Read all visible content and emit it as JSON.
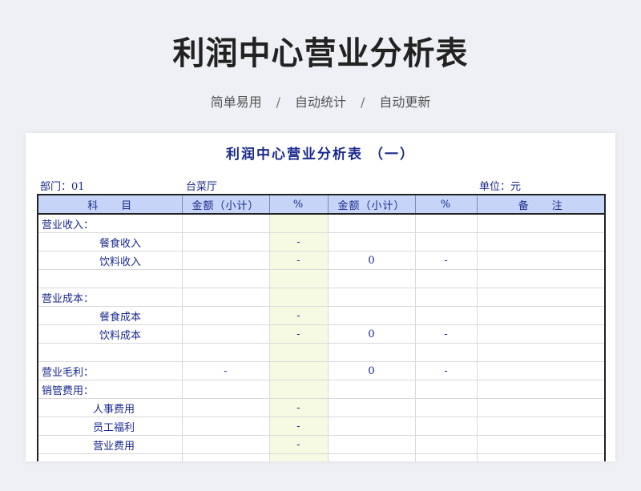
{
  "header": {
    "title": "利润中心营业分析表",
    "tagline": [
      "简单易用",
      "自动统计",
      "自动更新"
    ],
    "separator": "/"
  },
  "sheet": {
    "title": "利润中心营业分析表 （一）",
    "dept_label": "部门：01",
    "location": "台菜厅",
    "unit_label": "单位：元",
    "columns": [
      "科　　目",
      "金额（小计）",
      "%",
      "金额（小计）",
      "%",
      "备　　注"
    ],
    "rows": [
      {
        "label": "营业收入：",
        "amt1": "",
        "pct1": "",
        "amt2": "",
        "pct2": "",
        "note": ""
      },
      {
        "label": "餐食收入",
        "amt1": "",
        "pct1": "-",
        "amt2": "",
        "pct2": "",
        "note": ""
      },
      {
        "label": "饮料收入",
        "amt1": "",
        "pct1": "-",
        "amt2": "0",
        "pct2": "-",
        "note": ""
      },
      {
        "label": "",
        "amt1": "",
        "pct1": "",
        "amt2": "",
        "pct2": "",
        "note": ""
      },
      {
        "label": "营业成本：",
        "amt1": "",
        "pct1": "",
        "amt2": "",
        "pct2": "",
        "note": ""
      },
      {
        "label": "餐食成本",
        "amt1": "",
        "pct1": "-",
        "amt2": "",
        "pct2": "",
        "note": ""
      },
      {
        "label": "饮料成本",
        "amt1": "",
        "pct1": "-",
        "amt2": "0",
        "pct2": "-",
        "note": ""
      },
      {
        "label": "",
        "amt1": "",
        "pct1": "",
        "amt2": "",
        "pct2": "",
        "note": ""
      },
      {
        "label": "营业毛利：",
        "amt1": "-",
        "pct1": "",
        "amt2": "0",
        "pct2": "-",
        "note": ""
      },
      {
        "label": "销管费用：",
        "amt1": "",
        "pct1": "",
        "amt2": "",
        "pct2": "",
        "note": ""
      },
      {
        "label": "人事费用",
        "amt1": "",
        "pct1": "-",
        "amt2": "",
        "pct2": "",
        "note": ""
      },
      {
        "label": "员工福利",
        "amt1": "",
        "pct1": "-",
        "amt2": "",
        "pct2": "",
        "note": ""
      },
      {
        "label": "营业费用",
        "amt1": "",
        "pct1": "-",
        "amt2": "",
        "pct2": "",
        "note": ""
      },
      {
        "label": "",
        "amt1": "",
        "pct1": "",
        "amt2": "",
        "pct2": "",
        "note": ""
      }
    ]
  },
  "colors": {
    "header_fill": "#c6d5f7",
    "pct_fill": "#f6fae2",
    "text_blue": "#1a2a8c"
  }
}
